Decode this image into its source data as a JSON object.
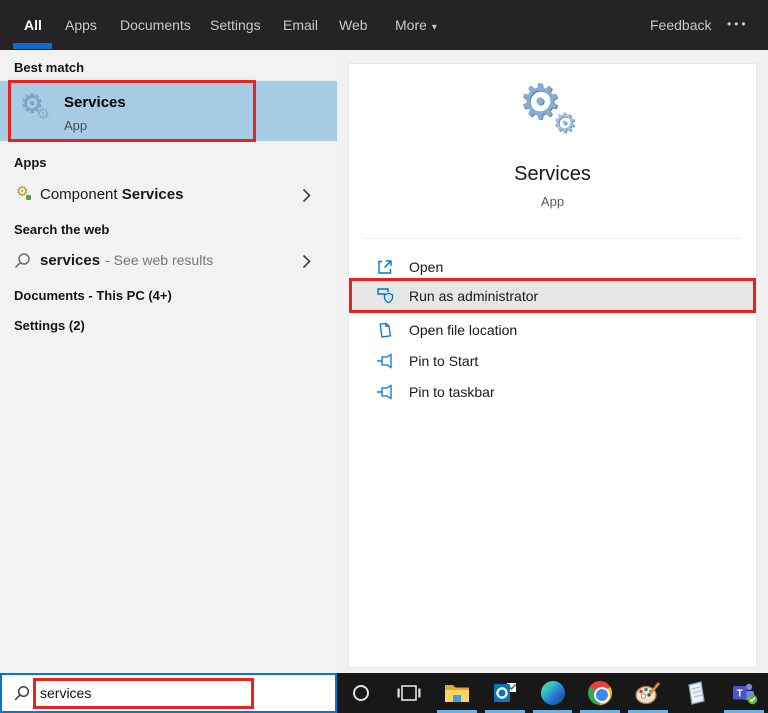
{
  "glyphs": {
    "gear": "⚙",
    "caret": "▾",
    "overflow": "•••"
  },
  "topbar": {
    "tabs": [
      {
        "label": "All",
        "active": true
      },
      {
        "label": "Apps",
        "active": false
      },
      {
        "label": "Documents",
        "active": false
      },
      {
        "label": "Settings",
        "active": false
      },
      {
        "label": "Email",
        "active": false
      },
      {
        "label": "Web",
        "active": false
      },
      {
        "label": "More",
        "active": false,
        "has_dropdown": true
      }
    ],
    "feedback": "Feedback"
  },
  "left_panel": {
    "best_match_header": "Best match",
    "best_match": {
      "title": "Services",
      "subtitle": "App"
    },
    "apps_header": "Apps",
    "apps_item": {
      "prefix": "Component",
      "match": "Services"
    },
    "web_header": "Search the web",
    "web_item": {
      "query": "services",
      "suffix": "- See web results"
    },
    "documents_header": "Documents - This PC (4+)",
    "settings_header": "Settings (2)"
  },
  "right_panel": {
    "title": "Services",
    "subtitle": "App",
    "actions": [
      {
        "label": "Open",
        "icon": "open-icon",
        "highlighted": false
      },
      {
        "label": "Run as administrator",
        "icon": "admin-shield-icon",
        "highlighted": true
      },
      {
        "label": "Open file location",
        "icon": "file-location-icon",
        "highlighted": false
      },
      {
        "label": "Pin to Start",
        "icon": "pin-icon",
        "highlighted": false
      },
      {
        "label": "Pin to taskbar",
        "icon": "pin-icon",
        "highlighted": false
      }
    ]
  },
  "search": {
    "value": "services"
  },
  "taskbar": {
    "icons": [
      {
        "name": "cortana",
        "active": false
      },
      {
        "name": "task-view",
        "active": false
      },
      {
        "name": "file-explorer",
        "active": true
      },
      {
        "name": "outlook",
        "active": true
      },
      {
        "name": "edge",
        "active": true
      },
      {
        "name": "chrome",
        "active": true
      },
      {
        "name": "paint",
        "active": true
      },
      {
        "name": "notes",
        "active": false
      },
      {
        "name": "teams",
        "active": true
      }
    ]
  },
  "colors": {
    "accent": "#0078d7",
    "annotation_red": "#e8231f",
    "best_match_highlight": "#a8cbe5",
    "admin_row_highlight": "#e6e6e6",
    "taskbar_underline": "#6cb2e8"
  },
  "annotations": {
    "highlighted_elements": [
      "best-match-row",
      "run-as-administrator-row",
      "search-input"
    ]
  }
}
